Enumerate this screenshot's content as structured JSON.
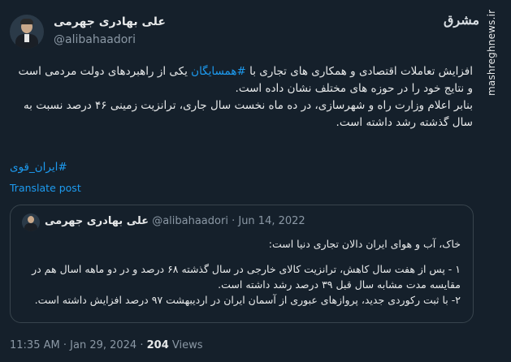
{
  "author": {
    "name": "علی بهادری جهرمی",
    "handle": "@alibahaadori"
  },
  "watermark": {
    "logo_text": "مشرق",
    "url": "mashreghnews.ir"
  },
  "tweet": {
    "line1_pre": "افزایش تعاملات اقتصادی و همکاری های تجاری با ",
    "line1_hashtag": "#همسایگان",
    "line1_post": " یکی از راهبردهای دولت مردمی است و نتایج خود را در حوزه های مختلف نشان داده است.",
    "line2": "بنابر اعلام وزارت راه و شهرسازی، در ده ماه نخست سال جاری، ترانزیت زمینی ۴۶ درصد نسبت به سال گذشته رشد داشته است.",
    "hashtag": "#ایران_قوی",
    "translate": "Translate post"
  },
  "quote": {
    "name": "علی بهادری جهرمی",
    "handle": "@alibahaadori",
    "dot": "·",
    "date": "Jun 14, 2022",
    "intro": "خاک، آب و هوای ایران دالان تجاری دنیا است:",
    "item1": "۱ - پس از هفت سال کاهش، ترانزیت کالای خارجی در سال گذشته ۶۸ درصد و در دو ماهه اسال هم در مقایسه مدت مشابه سال قبل ۳۹ درصد رشد داشته است.",
    "item2": "۲- با ثبت رکوردی جدید، پروازهای عبوری از آسمان ایران در اردیبهشت ۹۷ درصد افزایش داشته است."
  },
  "footer": {
    "time": "11:35 AM",
    "dot": "·",
    "date": "Jan 29, 2024",
    "views_count": "204",
    "views_label": "Views"
  }
}
